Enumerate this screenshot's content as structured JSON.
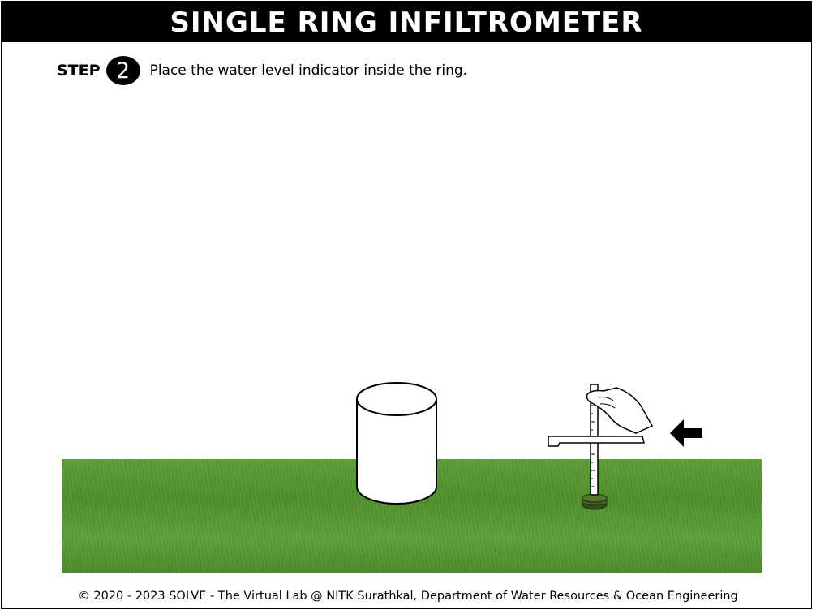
{
  "header": {
    "title": "SINGLE RING INFILTROMETER"
  },
  "step": {
    "label": "STEP",
    "number": "2",
    "instruction": "Place the water level indicator inside the ring."
  },
  "scene": {
    "icons": [
      "ring-icon",
      "water-level-indicator-icon",
      "hand-icon",
      "arrow-left-icon"
    ],
    "colors": {
      "grass": "#5a9a36",
      "indicator_base": "#3f5e1f"
    }
  },
  "footer": {
    "copyright": "© 2020 - 2023 SOLVE - The Virtual Lab @ NITK Surathkal, Department of Water Resources & Ocean Engineering"
  }
}
